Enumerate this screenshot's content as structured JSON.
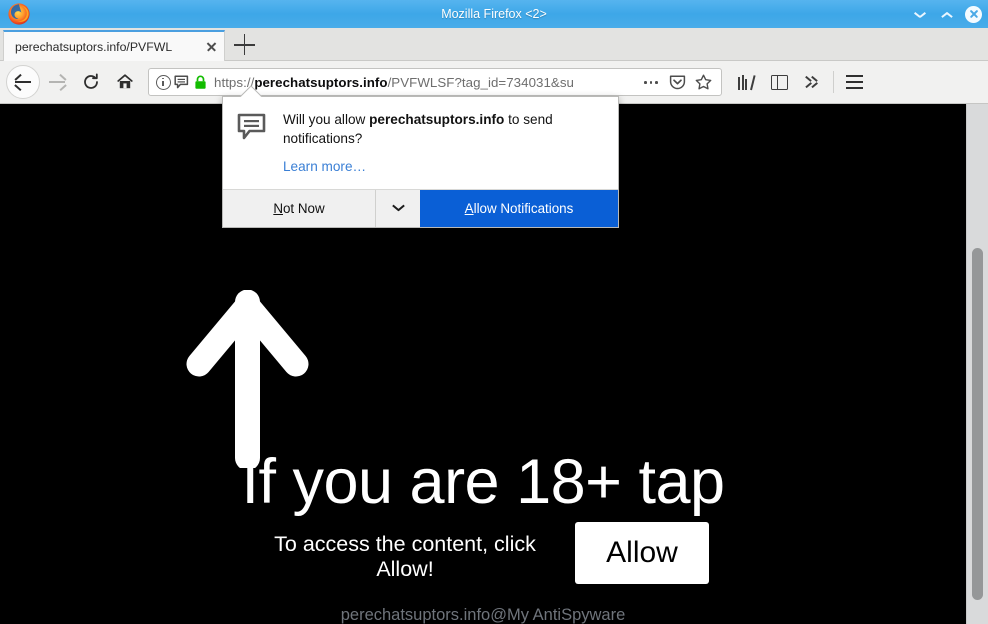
{
  "window": {
    "title": "Mozilla Firefox <2>",
    "logo_icon": "firefox-logo",
    "minimize_icon": "chevron-down-icon",
    "maximize_icon": "chevron-up-icon",
    "close_icon": "close-icon"
  },
  "tabs": {
    "items": [
      {
        "title": "perechatsuptors.info/PVFWL",
        "close_icon": "close-icon"
      }
    ],
    "new_tab_icon": "plus-icon"
  },
  "toolbar": {
    "back_icon": "arrow-left-icon",
    "forward_icon": "arrow-right-icon",
    "reload_icon": "reload-icon",
    "home_icon": "home-icon",
    "library_icon": "library-icon",
    "sidebar_icon": "sidebar-icon",
    "overflow_icon": "double-chevron-right-icon",
    "menu_icon": "hamburger-menu-icon"
  },
  "urlbar": {
    "info_icon": "info-circle-icon",
    "notification_icon": "notification-bubble-icon",
    "lock_icon": "padlock-icon",
    "scheme": "https://",
    "host": "perechatsuptors.info",
    "path": "/PVFWLSF?tag_id=734031&su",
    "full_url": "https://perechatsuptors.info/PVFWLSF?tag_id=734031&su",
    "page_actions_icon": "ellipsis-icon",
    "pocket_icon": "pocket-icon",
    "bookmark_icon": "star-icon"
  },
  "permission_popup": {
    "icon": "notification-bubble-icon",
    "question_prefix": "Will you allow ",
    "question_domain": "perechatsuptors.info",
    "question_suffix": " to send notifications?",
    "learn_more": "Learn more…",
    "not_now_label": "Not Now",
    "not_now_accesskey": "N",
    "dropdown_icon": "chevron-down-icon",
    "allow_label": "Allow Notifications",
    "allow_accesskey": "A",
    "allow_color": "#0a5fd6"
  },
  "page": {
    "arrow_icon": "arrow-up-icon",
    "headline": "If you are 18+ tap",
    "subtext": "To access the content, click Allow!",
    "allow_button": "Allow",
    "watermark": "perechatsuptors.info@My AntiSpyware",
    "background_color": "#000000",
    "text_color": "#ffffff"
  },
  "scrollbar": {
    "orientation": "vertical",
    "track_color": "#d9dadb",
    "thumb_color": "#959798"
  }
}
